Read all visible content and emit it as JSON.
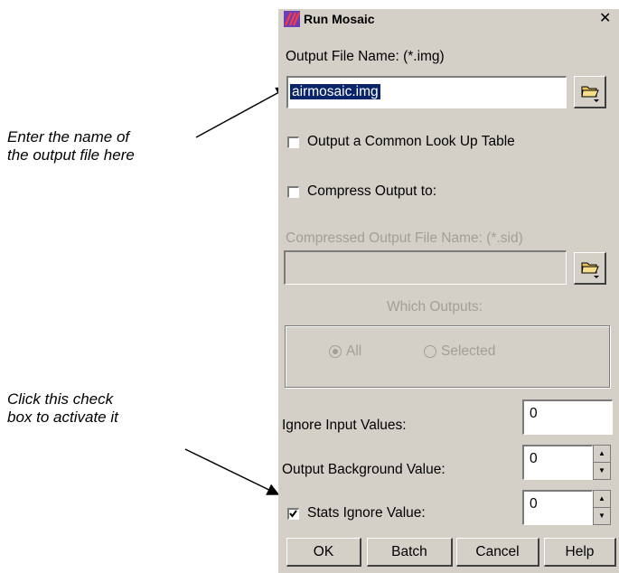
{
  "callouts": {
    "output_file": "Enter the name of\nthe output file here",
    "check_box": "Click this check\nbox to activate it"
  },
  "dialog": {
    "title": "Run Mosaic",
    "close_glyph": "✕",
    "output_file_label": "Output File Name: (*.img)",
    "output_file_value": "airmosaic.img",
    "common_lut_label": "Output a Common Look Up Table",
    "common_lut_checked": false,
    "compress_label": "Compress Output to:",
    "compress_checked": false,
    "compressed_file_label": "Compressed Output File Name: (*.sid)",
    "compressed_file_value": "",
    "which_outputs_label": "Which Outputs:",
    "radio_all_label": "All",
    "radio_selected_label": "Selected",
    "radio_selected_option": "All",
    "ignore_input_label": "Ignore Input Values:",
    "ignore_input_value": "0",
    "background_label": "Output Background Value:",
    "background_value": "0",
    "stats_ignore_label": "Stats Ignore Value:",
    "stats_ignore_value": "0",
    "stats_ignore_checked": true,
    "buttons": {
      "ok": "OK",
      "batch": "Batch",
      "cancel": "Cancel",
      "help": "Help"
    }
  },
  "colors": {
    "dialog_bg": "#d4d0c8",
    "selection": "#0a246a",
    "disabled_text": "#a39f98"
  },
  "icons": [
    "app-icon",
    "close-icon",
    "folder-icon",
    "checkbox-icon",
    "radio-icon",
    "spin-up-icon",
    "spin-down-icon"
  ]
}
